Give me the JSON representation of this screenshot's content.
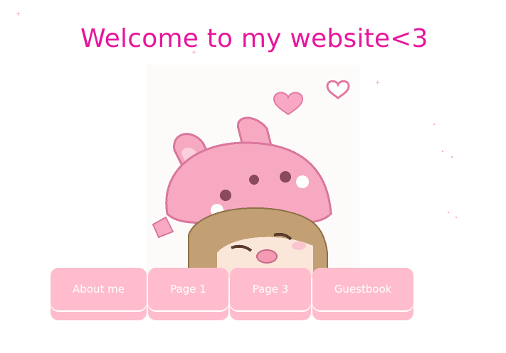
{
  "page": {
    "title": "Welcome to my website<3"
  },
  "hero_image": {
    "description_icon": "bunny-hood-girl-pixel-art-icon"
  },
  "nav": {
    "buttons": [
      {
        "label": "About me"
      },
      {
        "label": "Page 1"
      },
      {
        "label": "Page 3"
      },
      {
        "label": "Guestbook"
      }
    ]
  },
  "colors": {
    "title": "#e6169c",
    "button": "#ffbccc",
    "button_text": "#ffffff",
    "sparkle": "#f59cc6"
  }
}
